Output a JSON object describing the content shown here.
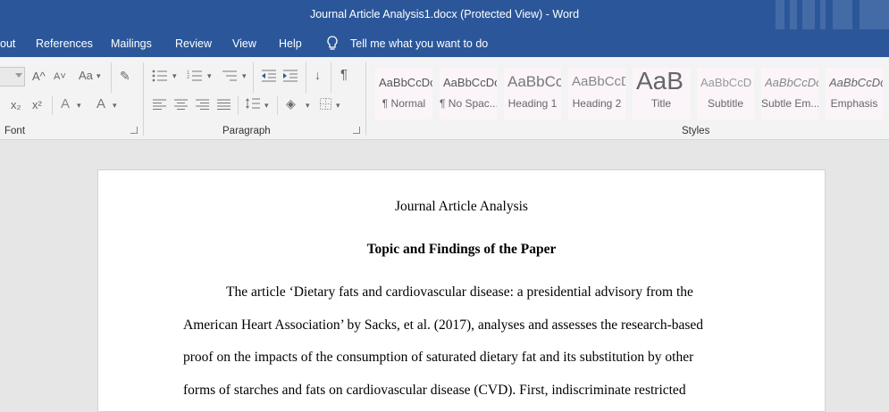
{
  "window": {
    "title": "Journal Article Analysis1.docx (Protected View)  -  Word"
  },
  "menu": {
    "items": [
      "out",
      "References",
      "Mailings",
      "Review",
      "View",
      "Help"
    ],
    "tell_me": "Tell me what you want to do"
  },
  "ribbon": {
    "groups": {
      "font": "Font",
      "paragraph": "Paragraph",
      "styles": "Styles"
    },
    "font_glyphs": {
      "grow": "A^",
      "shrink": "A˅",
      "change_case": "Aa",
      "subscript": "x₂",
      "superscript": "x²",
      "text_effects": "A",
      "font_color": "A"
    },
    "styles": [
      {
        "preview": "AaBbCcDc",
        "label": "¶ Normal"
      },
      {
        "preview": "AaBbCcDc",
        "label": "¶ No Spac..."
      },
      {
        "preview": "AaBbCc",
        "label": "Heading 1"
      },
      {
        "preview": "AaBbCcD",
        "label": "Heading 2"
      },
      {
        "preview": "AaB",
        "label": "Title"
      },
      {
        "preview": "AaBbCcD",
        "label": "Subtitle"
      },
      {
        "preview": "AaBbCcDc",
        "label": "Subtle Em..."
      },
      {
        "preview": "AaBbCcDc",
        "label": "Emphasis"
      }
    ]
  },
  "document": {
    "title": "Journal Article Analysis",
    "heading": "Topic and Findings of the Paper",
    "lines": [
      "The article ‘Dietary fats and cardiovascular disease: a presidential advisory from the",
      "American Heart Association’ by Sacks, et al. (2017), analyses and assesses the research-based",
      "proof on the impacts of the consumption of saturated dietary fat and its substitution by other",
      "forms of starches and fats on cardiovascular disease (CVD). First, indiscriminate restricted"
    ]
  },
  "colors": {
    "word_blue": "#2b579a",
    "ribbon_bg": "#f3f3f3",
    "canvas": "#e6e6e6"
  }
}
